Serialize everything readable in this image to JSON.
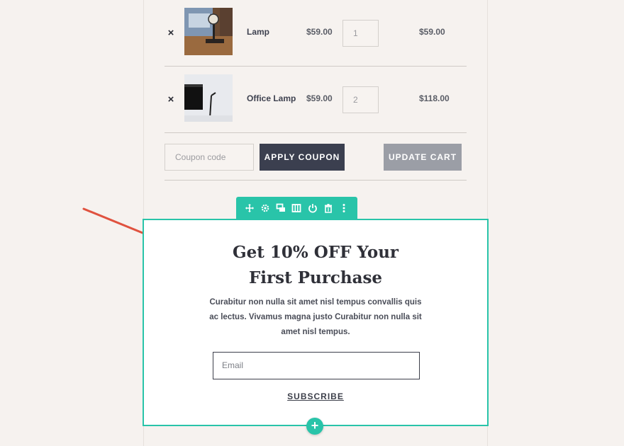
{
  "cart": {
    "items": [
      {
        "name": "Lamp",
        "price": "$59.00",
        "quantity": "1",
        "subtotal": "$59.00",
        "remove": "×"
      },
      {
        "name": "Office Lamp",
        "price": "$59.00",
        "quantity": "2",
        "subtotal": "$118.00",
        "remove": "×"
      }
    ],
    "coupon_placeholder": "Coupon code",
    "apply_label": "APPLY COUPON",
    "update_label": "UPDATE CART"
  },
  "toolbar": {
    "icons": [
      "move-icon",
      "gear-icon",
      "duplicate-icon",
      "columns-icon",
      "power-icon",
      "trash-icon",
      "more-icon"
    ]
  },
  "optin": {
    "title": "Get 10% OFF Your First Purchase",
    "description": "Curabitur non nulla sit amet nisl tempus convallis quis ac lectus. Vivamus magna justo Curabitur non nulla sit amet nisl tempus.",
    "email_placeholder": "Email",
    "subscribe_label": "SUBSCRIBE",
    "add_label": "+"
  },
  "colors": {
    "accent": "#29c4a9",
    "dark_button": "#3b3f4f",
    "gray_button": "#9b9ea6",
    "arrow": "#e0523f",
    "background": "#f6f2ef"
  }
}
